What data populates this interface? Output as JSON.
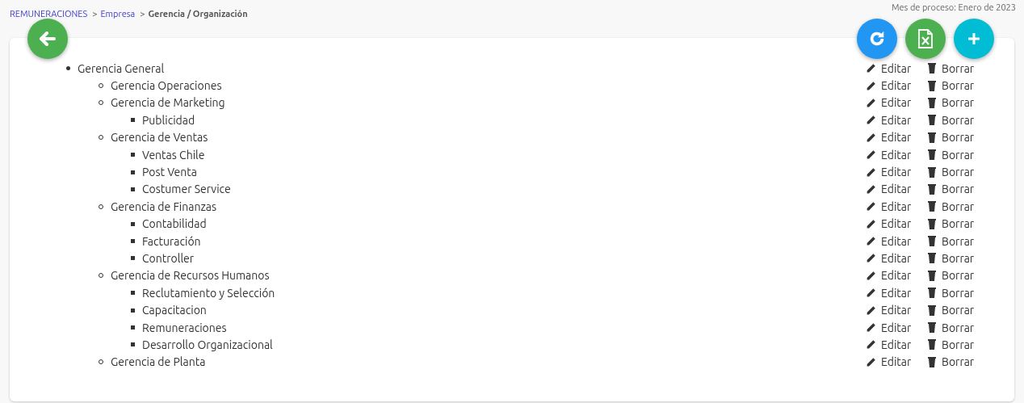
{
  "breadcrumb": [
    {
      "text": "REMUNERACIONES",
      "current": false
    },
    {
      "prefix": ">",
      "text": "Empresa",
      "current": false
    },
    {
      "prefix": ">",
      "text": "Gerencia / Organización",
      "current": true
    }
  ],
  "process_month": "Mes de proceso: Enero de 2023",
  "tree": [
    {
      "label": "Gerencia General",
      "edit": "Editar",
      "delete": "Borrar",
      "children": [
        {
          "label": "Gerencia Operaciones",
          "edit": "Editar",
          "delete": "Borrar"
        },
        {
          "label": "Gerencia de Marketing",
          "edit": "Editar",
          "delete": "Borrar",
          "children": [
            {
              "label": "Publicidad",
              "edit": "Editar",
              "delete": "Borrar"
            }
          ]
        },
        {
          "label": "Gerencia de Ventas",
          "edit": "Editar",
          "delete": "Borrar",
          "children": [
            {
              "label": "Ventas Chile",
              "edit": "Editar",
              "delete": "Borrar"
            },
            {
              "label": "Post Venta",
              "edit": "Editar",
              "delete": "Borrar"
            },
            {
              "label": "Costumer Service",
              "edit": "Editar",
              "delete": "Borrar"
            }
          ]
        },
        {
          "label": "Gerencia de Finanzas",
          "edit": "Editar",
          "delete": "Borrar",
          "children": [
            {
              "label": "Contabilidad",
              "edit": "Editar",
              "delete": "Borrar"
            },
            {
              "label": "Facturación",
              "edit": "Editar",
              "delete": "Borrar"
            },
            {
              "label": "Controller",
              "edit": "Editar",
              "delete": "Borrar"
            }
          ]
        },
        {
          "label": "Gerencia de Recursos Humanos",
          "edit": "Editar",
          "delete": "Borrar",
          "children": [
            {
              "label": "Reclutamiento y Selección",
              "edit": "Editar",
              "delete": "Borrar"
            },
            {
              "label": "Capacitacion",
              "edit": "Editar",
              "delete": "Borrar"
            },
            {
              "label": "Remuneraciones",
              "edit": "Editar",
              "delete": "Borrar"
            },
            {
              "label": "Desarrollo Organizacional",
              "edit": "Editar",
              "delete": "Borrar"
            }
          ]
        },
        {
          "label": "Gerencia de Planta",
          "edit": "Editar",
          "delete": "Borrar"
        }
      ]
    }
  ]
}
